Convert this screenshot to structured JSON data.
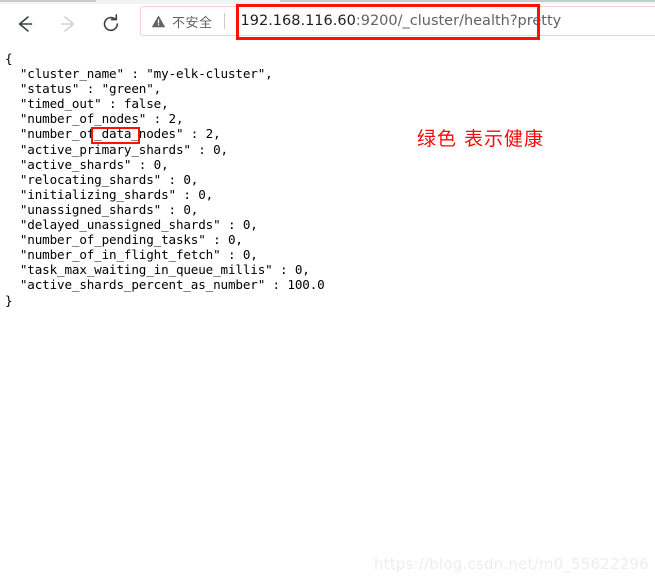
{
  "browser": {
    "toolbar": {
      "back_icon": "back-arrow-icon",
      "forward_icon": "forward-arrow-icon",
      "reload_icon": "reload-icon"
    },
    "omnibox": {
      "security_icon": "warning-triangle-icon",
      "security_label": "不安全",
      "url_host": "192.168.116.60",
      "url_rest": ":9200/_cluster/health?pretty",
      "url_full": "192.168.116.60:9200/_cluster/health?pretty"
    }
  },
  "page": {
    "json_body": "{\n  \"cluster_name\" : \"my-elk-cluster\",\n  \"status\" : \"green\",\n  \"timed_out\" : false,\n  \"number_of_nodes\" : 2,\n  \"number_of_data_nodes\" : 2,\n  \"active_primary_shards\" : 0,\n  \"active_shards\" : 0,\n  \"relocating_shards\" : 0,\n  \"initializing_shards\" : 0,\n  \"unassigned_shards\" : 0,\n  \"delayed_unassigned_shards\" : 0,\n  \"number_of_pending_tasks\" : 0,\n  \"number_of_in_flight_fetch\" : 0,\n  \"task_max_waiting_in_queue_millis\" : 0,\n  \"active_shards_percent_as_number\" : 100.0\n}",
    "cluster_health": {
      "cluster_name": "my-elk-cluster",
      "status": "green",
      "timed_out": "false",
      "number_of_nodes": "2",
      "number_of_data_nodes": "2",
      "active_primary_shards": "0",
      "active_shards": "0",
      "relocating_shards": "0",
      "initializing_shards": "0",
      "unassigned_shards": "0",
      "delayed_unassigned_shards": "0",
      "number_of_pending_tasks": "0",
      "number_of_in_flight_fetch": "0",
      "task_max_waiting_in_queue_millis": "0",
      "active_shards_percent_as_number": "100.0"
    },
    "annotation_text": "绿色 表示健康",
    "watermark": "https://blog.csdn.net/m0_55622296"
  },
  "colors": {
    "annotation_red": "#fb0a05",
    "highlight_box_red": "#fa1205",
    "url_host_text": "#202124",
    "url_rest_text": "#5f6368",
    "watermark_gray": "#ededed"
  }
}
